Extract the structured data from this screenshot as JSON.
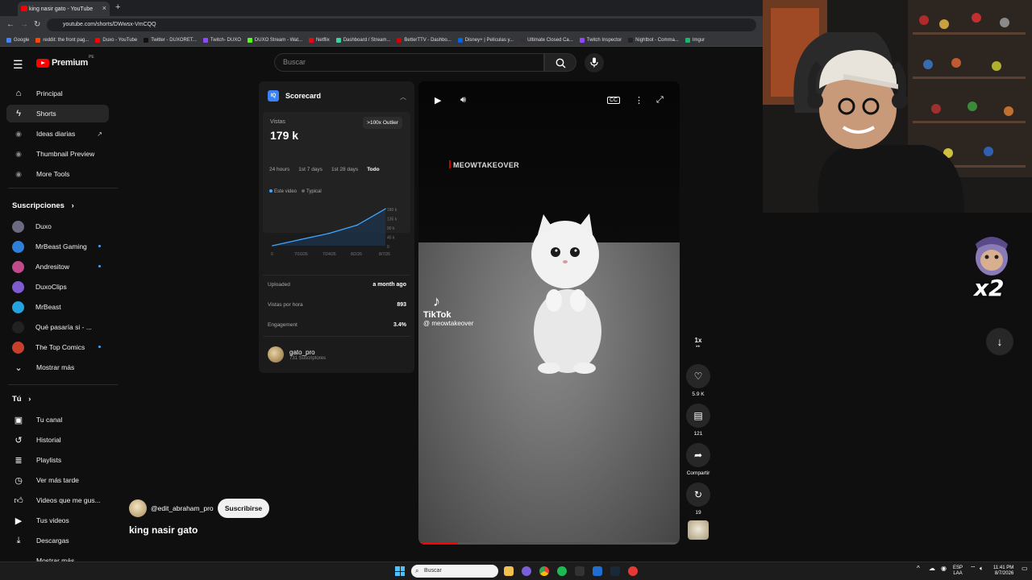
{
  "browser": {
    "tab_title": "king nasir gato - YouTube",
    "url": "youtube.com/shorts/DWwsx-VmCQQ",
    "bookmarks": [
      "Google",
      "reddit: the front pag...",
      "Duxo - YouTube",
      "Twitter - DUXORET...",
      "Twitch- DUXO",
      "DUXO Stream - Wat...",
      "Netflix",
      "Dashboard / Stream...",
      "BetterTTV - Dashbo...",
      "Disney+ | Películas y...",
      "Ultimate Closed Ca...",
      "Twitch Inspector",
      "Nightbot - Comma...",
      "Imgur"
    ],
    "bookmark_colors": [
      "#4285f4",
      "#ff4500",
      "#ff0000",
      "#111111",
      "#9146ff",
      "#53fc18",
      "#e50914",
      "#3ad39b",
      "#d50000",
      "#0063e5",
      "#333333",
      "#9146ff",
      "#222222",
      "#1bb76e"
    ]
  },
  "logo": {
    "text": "Premium",
    "region": "PE"
  },
  "search": {
    "placeholder": "Buscar"
  },
  "sidebar": {
    "main": [
      {
        "label": "Principal",
        "icon": "home-icon"
      },
      {
        "label": "Shorts",
        "icon": "shorts-icon"
      },
      {
        "label": "Ideas diarias",
        "icon": "ideas-icon"
      },
      {
        "label": "Thumbnail Preview",
        "icon": "thumbnail-icon"
      },
      {
        "label": "More Tools",
        "icon": "tools-icon"
      }
    ],
    "subs_header": "Suscripciones",
    "subs": [
      {
        "label": "Duxo",
        "color": "#6a6a80"
      },
      {
        "label": "MrBeast Gaming",
        "color": "#2f7fd8"
      },
      {
        "label": "Andresitow",
        "color": "#c04a8a"
      },
      {
        "label": "DuxoClips",
        "color": "#7e5cd0"
      },
      {
        "label": "MrBeast",
        "color": "#25a2e0"
      },
      {
        "label": "Qué pasaría si - ...",
        "color": "#222222"
      },
      {
        "label": "The Top Comics",
        "color": "#c8402c"
      }
    ],
    "more": "Mostrar más",
    "you_header": "Tú",
    "you": [
      {
        "label": "Tu canal",
        "icon": "channel-icon"
      },
      {
        "label": "Historial",
        "icon": "history-icon"
      },
      {
        "label": "Playlists",
        "icon": "playlists-icon"
      },
      {
        "label": "Ver más tarde",
        "icon": "watch-later-icon"
      },
      {
        "label": "Videos que me gus...",
        "icon": "liked-icon"
      },
      {
        "label": "Tus videos",
        "icon": "your-videos-icon"
      },
      {
        "label": "Descargas",
        "icon": "downloads-icon"
      },
      {
        "label": "Mostrar más",
        "icon": "chevron-down-icon"
      }
    ]
  },
  "scorecard": {
    "title": "Scorecard",
    "logo": "IQ",
    "views_label": "Vistas",
    "views_value": "179 k",
    "outlier": ">100x Outlier",
    "periods": [
      "24 hours",
      "1st 7 days",
      "1st 28 days",
      "Todo"
    ],
    "legend": [
      "Este video",
      "Typical"
    ],
    "rows": [
      {
        "label": "Uploaded",
        "value": "a month ago"
      },
      {
        "label": "Vistas por hora",
        "value": "893"
      },
      {
        "label": "Engagement",
        "value": "3.4%"
      }
    ],
    "channel": {
      "name": "gato_pro",
      "subs": "731 Suscriptores"
    }
  },
  "chart_data": {
    "type": "line",
    "x": [
      "0",
      "7/16/26",
      "7/24/26",
      "8/2/26",
      "8/7/26"
    ],
    "series": [
      {
        "name": "Este video",
        "values": [
          0,
          30,
          60,
          100,
          179
        ]
      }
    ],
    "yticks": [
      "180 k",
      "135 k",
      "90 k",
      "45 k",
      "0"
    ],
    "ylim": [
      0,
      180
    ]
  },
  "video": {
    "watermark": "MEOWTAKEOVER",
    "tiktok_label": "TikTok",
    "tiktok_handle": "@ meowtakeover",
    "progress": 0.15
  },
  "actions": {
    "speed": "1x",
    "likes": "5.9 K",
    "comments": "121",
    "share": "Compartir",
    "remix": "19"
  },
  "channel": {
    "handle": "@edit_abraham_pro",
    "subscribe": "Suscribirse"
  },
  "title": "king nasir gato",
  "overlay": {
    "text": "x2"
  },
  "taskbar": {
    "search": "Buscar",
    "lang": "ESP",
    "region": "LAA",
    "time": "11:41 PM",
    "date": "8/7/2026"
  }
}
